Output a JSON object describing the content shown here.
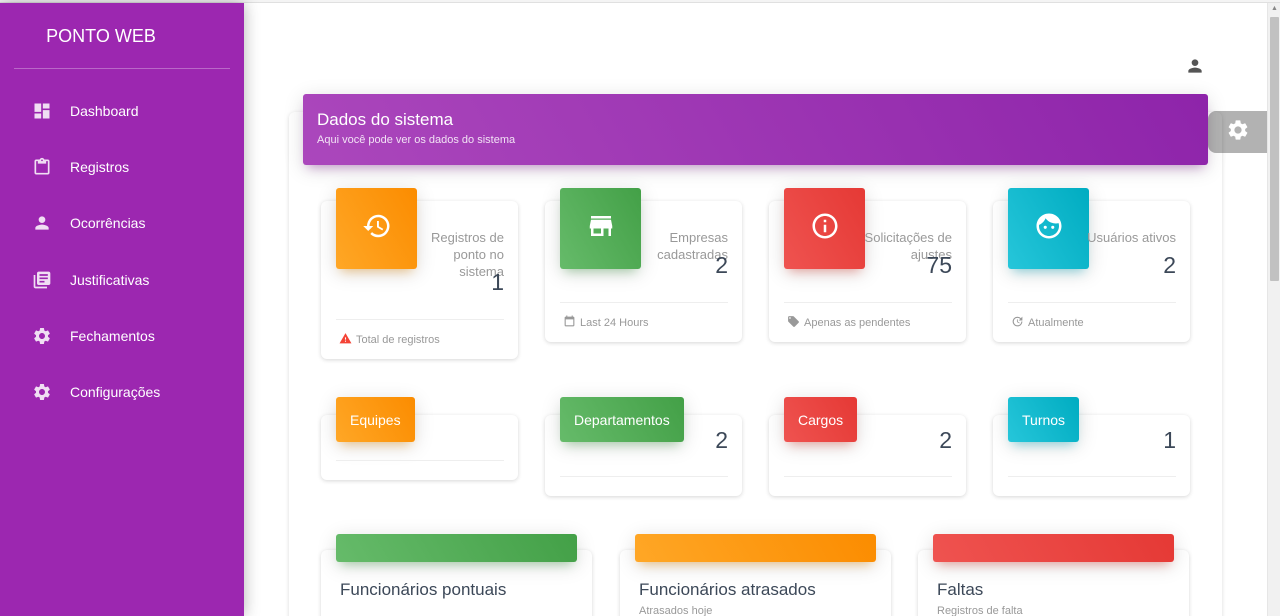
{
  "app": {
    "brand": "PONTO WEB"
  },
  "sidebar": {
    "items": [
      {
        "label": "Dashboard",
        "icon": "dashboard-icon"
      },
      {
        "label": "Registros",
        "icon": "clipboard-icon"
      },
      {
        "label": "Ocorrências",
        "icon": "person-icon"
      },
      {
        "label": "Justificativas",
        "icon": "library-books-icon"
      },
      {
        "label": "Fechamentos",
        "icon": "gear-icon"
      },
      {
        "label": "Configurações",
        "icon": "gear-icon"
      }
    ]
  },
  "header": {
    "title": "Dados do sistema",
    "subtitle": "Aqui você pode ver os dados do sistema"
  },
  "stats": [
    {
      "category": "Registros de ponto no sistema",
      "value": "1",
      "footer": "Total de registros",
      "icon": "history-icon",
      "footer_icon": "warning-icon",
      "color": "#fb8c00"
    },
    {
      "category": "Empresas cadastradas",
      "value": "2",
      "footer": "Last 24 Hours",
      "icon": "store-icon",
      "footer_icon": "calendar-icon",
      "color": "#43a047"
    },
    {
      "category": "Solicitações de ajustes",
      "value": "75",
      "footer": "Apenas as pendentes",
      "icon": "info-icon",
      "footer_icon": "tag-icon",
      "color": "#e53935"
    },
    {
      "category": "Usuários ativos",
      "value": "2",
      "footer": "Atualmente",
      "icon": "face-icon",
      "footer_icon": "update-icon",
      "color": "#00acc1"
    }
  ],
  "small_cards": [
    {
      "label": "Equipes",
      "value": ""
    },
    {
      "label": "Departamentos",
      "value": "2"
    },
    {
      "label": "Cargos",
      "value": "2"
    },
    {
      "label": "Turnos",
      "value": "1"
    }
  ],
  "bottom_cards": [
    {
      "title": "Funcionários pontuais",
      "subtitle": ""
    },
    {
      "title": "Funcionários atrasados",
      "subtitle": "Atrasados hoje"
    },
    {
      "title": "Faltas",
      "subtitle": "Registros de falta"
    }
  ],
  "colors": {
    "sidebar": "#9c27b0",
    "header": "#8e24aa",
    "orange": "#fb8c00",
    "green": "#43a047",
    "red": "#e53935",
    "cyan": "#00acc1"
  }
}
